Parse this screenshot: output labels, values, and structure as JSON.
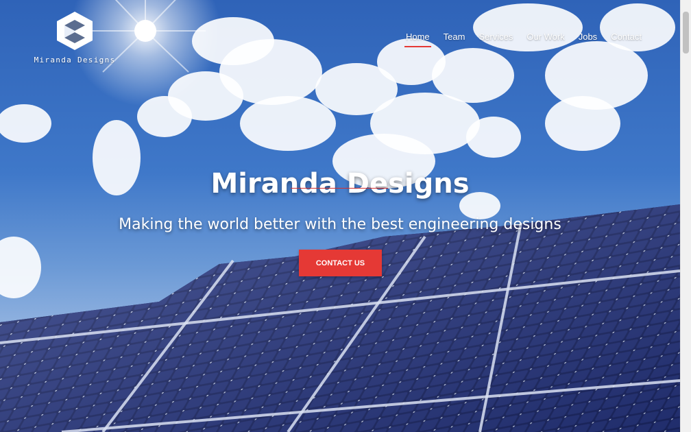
{
  "site": {
    "logo_text": "Miranda Designs"
  },
  "nav": {
    "items": [
      {
        "label": "Home",
        "active": true
      },
      {
        "label": "Team",
        "active": false
      },
      {
        "label": "Services",
        "active": false
      },
      {
        "label": "Our Work",
        "active": false
      },
      {
        "label": "Jobs",
        "active": false
      },
      {
        "label": "Contact",
        "active": false
      }
    ]
  },
  "hero": {
    "title": "Miranda Designs",
    "subtitle": "Making the world better with the best engineering designs",
    "cta_label": "CONTACT US",
    "background_icon": "solar-panels-sky-image"
  },
  "colors": {
    "accent": "#e53935",
    "sky": "#3f78c9",
    "panel": "#1d2a6b"
  }
}
